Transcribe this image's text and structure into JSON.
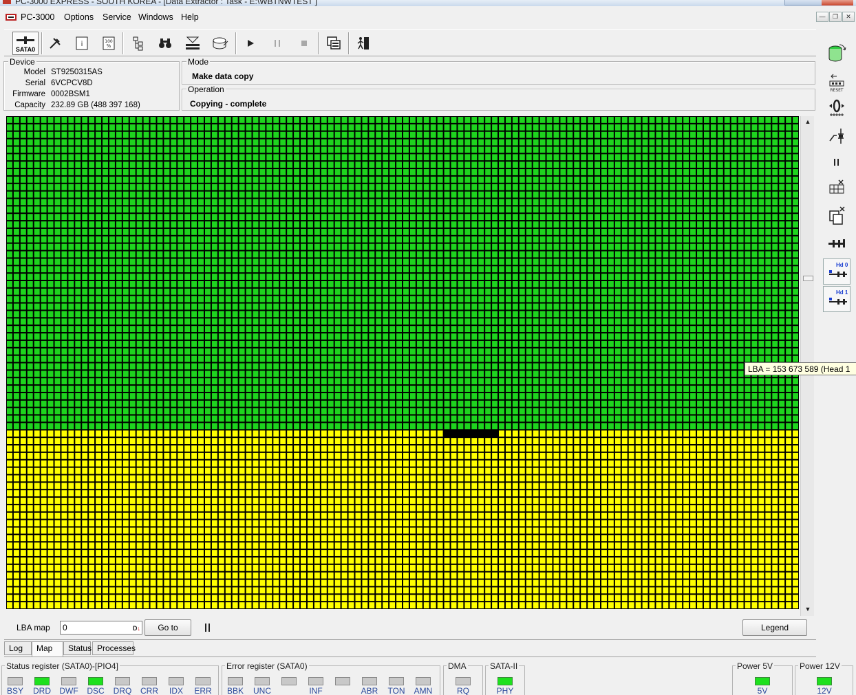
{
  "window": {
    "title": "PC-3000 EXPRESS - SOUTH KOREA - [Data Extractor : Task - E:\\WBTNWTEST ]"
  },
  "menu": {
    "app": "PC-3000",
    "items": [
      "Options",
      "Service",
      "Windows",
      "Help"
    ]
  },
  "toolbar": {
    "sata_label": "SATA0"
  },
  "device": {
    "legend": "Device",
    "model_label": "Model",
    "model": "ST9250315AS",
    "serial_label": "Serial",
    "serial": "6VCPCV8D",
    "firmware_label": "Firmware",
    "firmware": "0002BSM1",
    "capacity_label": "Capacity",
    "capacity": "232.89 GB (488 397 168)"
  },
  "mode": {
    "legend": "Mode",
    "value": "Make data copy"
  },
  "operation": {
    "legend": "Operation",
    "value": "Copying - complete"
  },
  "map": {
    "colors": {
      "copied": "#1ed41e",
      "pending": "#ffff00",
      "bad": "#000000",
      "border": "#000000"
    },
    "green_rows": 42,
    "total_rows": 66,
    "columns": 116,
    "bad_cells_row": 42,
    "bad_cells_from_col": 64,
    "bad_cells_count": 8
  },
  "tooltip": {
    "text": "LBA =  153 673 589 (Head 1"
  },
  "controls": {
    "lba_map_label": "LBA map",
    "lba_value": "0",
    "goto_label": "Go to",
    "legend_label": "Legend"
  },
  "tabs": [
    "Log",
    "Map",
    "Status",
    "Processes"
  ],
  "status_register": {
    "legend": "Status register (SATA0)-[PIO4]",
    "leds": [
      {
        "label": "BSY",
        "on": false
      },
      {
        "label": "DRD",
        "on": true
      },
      {
        "label": "DWF",
        "on": false
      },
      {
        "label": "DSC",
        "on": true
      },
      {
        "label": "DRQ",
        "on": false
      },
      {
        "label": "CRR",
        "on": false
      },
      {
        "label": "IDX",
        "on": false
      },
      {
        "label": "ERR",
        "on": false
      }
    ]
  },
  "error_register": {
    "legend": "Error register (SATA0)",
    "leds": [
      {
        "label": "BBK",
        "on": false
      },
      {
        "label": "UNC",
        "on": false
      },
      {
        "label": "",
        "on": false
      },
      {
        "label": "INF",
        "on": false
      },
      {
        "label": "",
        "on": false
      },
      {
        "label": "ABR",
        "on": false
      },
      {
        "label": "TON",
        "on": false
      },
      {
        "label": "AMN",
        "on": false
      }
    ]
  },
  "dma": {
    "legend": "DMA",
    "led": {
      "label": "RQ",
      "on": false
    }
  },
  "sata2": {
    "legend": "SATA-II",
    "led": {
      "label": "PHY",
      "on": true
    }
  },
  "power5": {
    "legend": "Power 5V",
    "led": {
      "label": "5V",
      "on": true
    }
  },
  "power12": {
    "legend": "Power 12V",
    "led": {
      "label": "12V",
      "on": true
    }
  },
  "rightbar": {
    "reset_label": "RESET",
    "hd0_label": "Hd 0",
    "hd1_label": "Hd 1"
  }
}
